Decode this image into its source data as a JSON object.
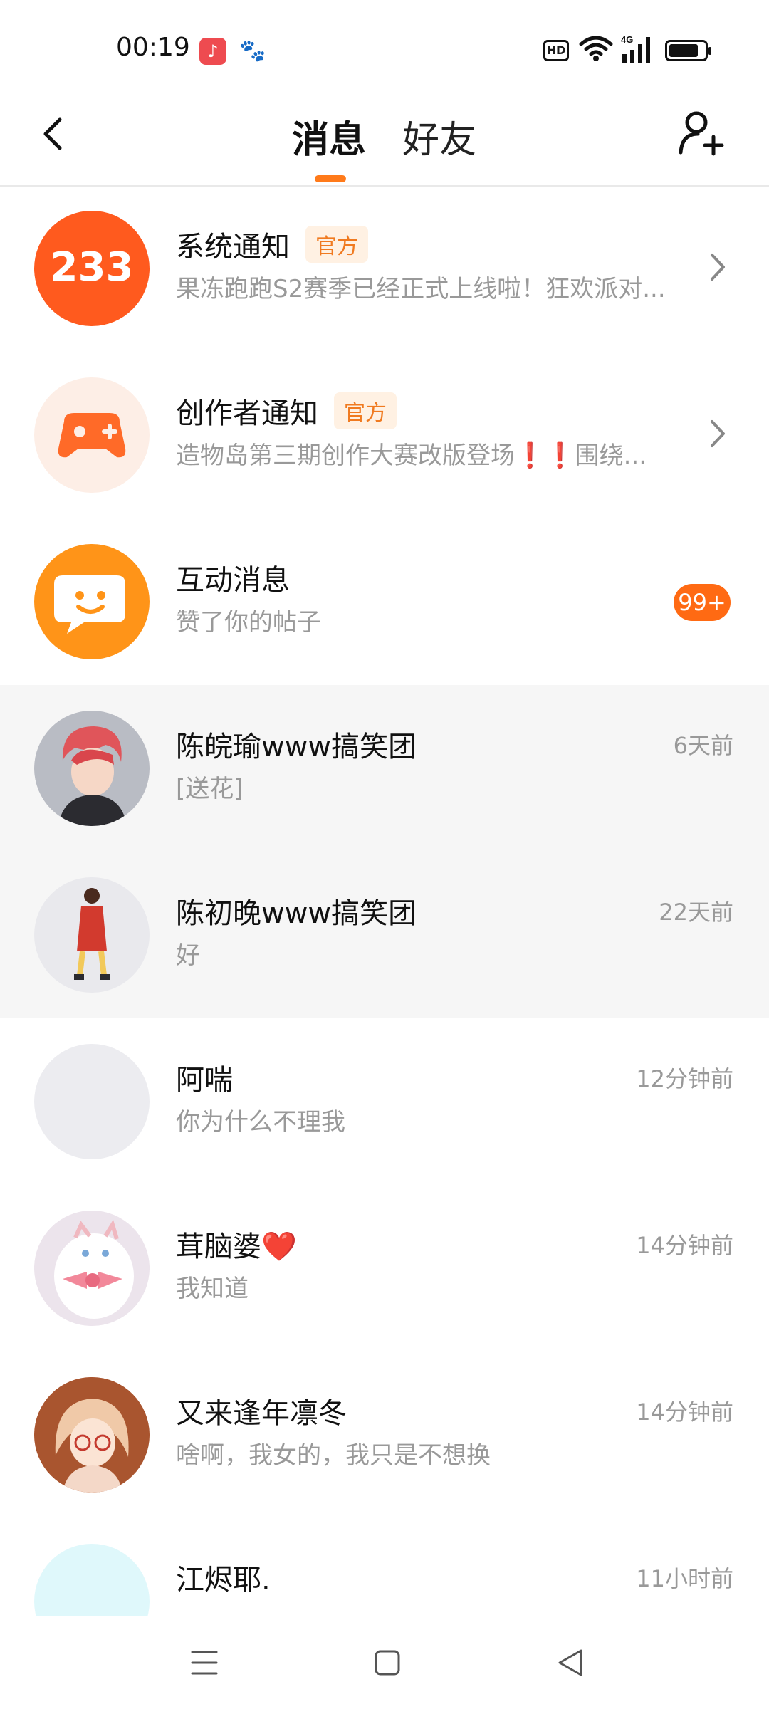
{
  "status_bar": {
    "time": "00:19",
    "hd": "HD",
    "network": "4G",
    "icons": [
      "music-app-icon",
      "baidu-paw-icon",
      "hd-icon",
      "wifi-icon",
      "signal-icon",
      "battery-icon"
    ]
  },
  "header": {
    "tabs": [
      {
        "label": "消息",
        "active": true
      },
      {
        "label": "好友",
        "active": false
      }
    ],
    "accent_color": "#ff7a1a"
  },
  "rows": [
    {
      "name": "系统通知",
      "badge": "官方",
      "preview": "果冻跑跑S2赛季已经正式上线啦！狂欢派对...",
      "icon": "233-logo-icon"
    },
    {
      "name": "创作者通知",
      "badge": "官方",
      "preview": "造物岛第三期创作大赛改版登场❗❗围绕...",
      "icon": "gamepad-icon"
    },
    {
      "name": "互动消息",
      "preview": "赞了你的帖子",
      "count": "99+",
      "icon": "chat-face-icon"
    },
    {
      "name": "陈皖瑜www搞笑团",
      "preview": "[送花]",
      "time": "6天前"
    },
    {
      "name": "陈初晚www搞笑团",
      "preview": "好",
      "time": "22天前"
    },
    {
      "name": "阿喘",
      "preview": "你为什么不理我",
      "time": "12分钟前"
    },
    {
      "name": "茸脑婆❤️",
      "preview": "我知道",
      "time": "14分钟前"
    },
    {
      "name": "又来逢年凛冬",
      "preview": "啥啊，我女的，我只是不想换",
      "time": "14分钟前"
    },
    {
      "name": "江烬耶.",
      "preview": "",
      "time": "11小时前"
    }
  ],
  "nav": {
    "icons": [
      "menu-icon",
      "home-square-icon",
      "back-triangle-icon"
    ]
  }
}
